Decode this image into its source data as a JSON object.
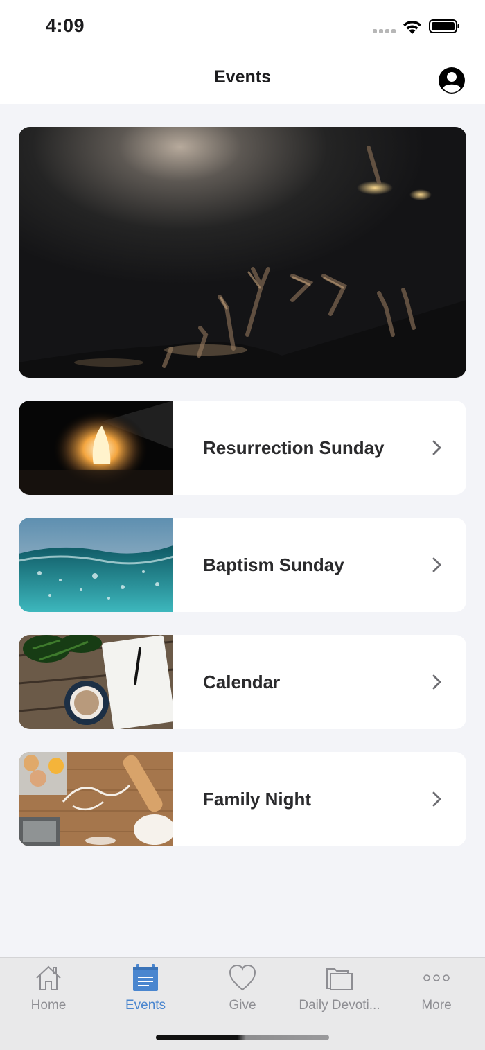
{
  "status_bar": {
    "time": "4:09"
  },
  "nav": {
    "title": "Events",
    "profile_icon": "person-circle-icon"
  },
  "hero": {
    "image": "worship-hands-raised-photo"
  },
  "events": [
    {
      "label": "Resurrection Sunday",
      "thumb": "empty-tomb-light-photo"
    },
    {
      "label": "Baptism Sunday",
      "thumb": "ocean-water-photo"
    },
    {
      "label": "Calendar",
      "thumb": "desk-notebook-coffee-photo"
    },
    {
      "label": "Family Night",
      "thumb": "family-flour-baking-photo"
    }
  ],
  "tabs": [
    {
      "label": "Home",
      "icon": "house-icon",
      "active": false
    },
    {
      "label": "Events",
      "icon": "calendar-icon",
      "active": true
    },
    {
      "label": "Give",
      "icon": "heart-icon",
      "active": false
    },
    {
      "label": "Daily Devoti...",
      "icon": "folder-icon",
      "active": false
    },
    {
      "label": "More",
      "icon": "ellipsis-icon",
      "active": false
    }
  ],
  "colors": {
    "accent": "#4a86cf",
    "inactive": "#8e8e93",
    "background": "#f3f4f8"
  }
}
